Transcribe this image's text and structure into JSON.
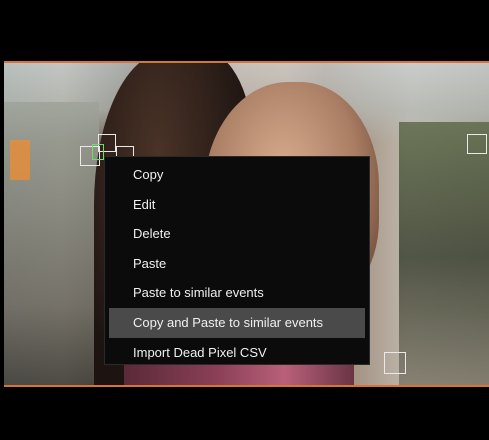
{
  "viewer": {
    "description_colors": {
      "accent_line": "#d8743a",
      "menu_bg": "#0b0b0b",
      "menu_hover": "#4a4a4a"
    }
  },
  "context_menu": {
    "items": [
      {
        "label": "Copy"
      },
      {
        "label": "Edit"
      },
      {
        "label": "Delete"
      },
      {
        "label": "Paste"
      },
      {
        "label": "Paste to similar events"
      },
      {
        "label": "Copy and Paste to similar events",
        "highlighted": true
      },
      {
        "label": "Import Dead Pixel CSV"
      }
    ]
  }
}
